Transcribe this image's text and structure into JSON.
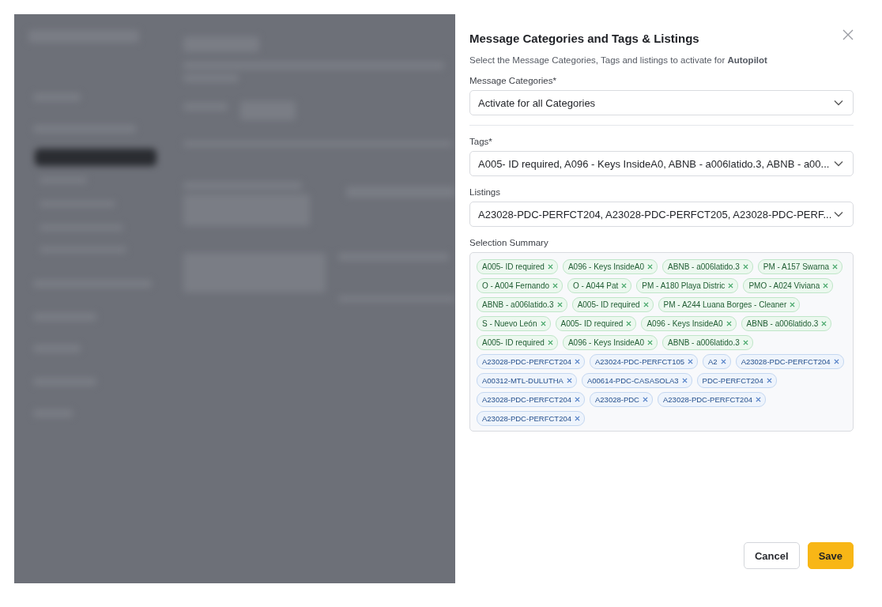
{
  "modal": {
    "title": "Message Categories and Tags & Listings",
    "subtitle": "Select the Message Categories, Tags and listings to activate for **Autopilot**",
    "fields": [
      {
        "label": "Message Categories*",
        "value": "Activate for all Categories"
      },
      {
        "label": "Tags*",
        "value": "A005- ID required, A096 - Keys InsideA0, ABNB - a006latido.3, ABNB - a00..."
      },
      {
        "label": "Listings",
        "value": "A23028-PDC-PERFCT204, A23028-PDC-PERFCT205, A23028-PDC-PERF..."
      }
    ],
    "summary_label": "Selection Summary",
    "chips": [
      {
        "kind": "tag",
        "text": "A005- ID required"
      },
      {
        "kind": "tag",
        "text": "A096 - Keys InsideA0"
      },
      {
        "kind": "tag",
        "text": "ABNB - a006latido.3"
      },
      {
        "kind": "tag",
        "text": "PM - A157 Swarna"
      },
      {
        "kind": "tag",
        "text": "O - A004 Fernando"
      },
      {
        "kind": "tag",
        "text": "O - A044 Pat"
      },
      {
        "kind": "tag",
        "text": "PM - A180 Playa Distric"
      },
      {
        "kind": "tag",
        "text": "PMO - A024 Viviana"
      },
      {
        "kind": "tag",
        "text": "ABNB - a006latido.3"
      },
      {
        "kind": "tag",
        "text": "A005- ID required"
      },
      {
        "kind": "tag",
        "text": "PM - A244 Luana Borges - Cleaner"
      },
      {
        "kind": "tag",
        "text": "S - Nuevo León"
      },
      {
        "kind": "tag",
        "text": "A005- ID required"
      },
      {
        "kind": "tag",
        "text": "A096 - Keys InsideA0"
      },
      {
        "kind": "tag",
        "text": "ABNB - a006latido.3"
      },
      {
        "kind": "tag",
        "text": "A005- ID required"
      },
      {
        "kind": "tag",
        "text": "A096 - Keys InsideA0"
      },
      {
        "kind": "tag",
        "text": "ABNB - a006latido.3"
      },
      {
        "kind": "listing",
        "text": "A23028-PDC-PERFCT204"
      },
      {
        "kind": "listing",
        "text": "A23024-PDC-PERFCT105"
      },
      {
        "kind": "listing",
        "text": "A2"
      },
      {
        "kind": "listing",
        "text": "A23028-PDC-PERFCT204"
      },
      {
        "kind": "listing",
        "text": "A00312-MTL-DULUTHA"
      },
      {
        "kind": "listing",
        "text": "A00614-PDC-CASASOLA3"
      },
      {
        "kind": "listing",
        "text": "PDC-PERFCT204"
      },
      {
        "kind": "listing",
        "text": "A23028-PDC-PERFCT204"
      },
      {
        "kind": "listing",
        "text": "A23028-PDC"
      },
      {
        "kind": "listing",
        "text": "A23028-PDC-PERFCT204"
      },
      {
        "kind": "listing",
        "text": "A23028-PDC-PERFCT204"
      }
    ],
    "buttons": [
      {
        "kind": "secondary",
        "label": "Cancel"
      },
      {
        "kind": "primary",
        "label": "Save"
      }
    ]
  }
}
